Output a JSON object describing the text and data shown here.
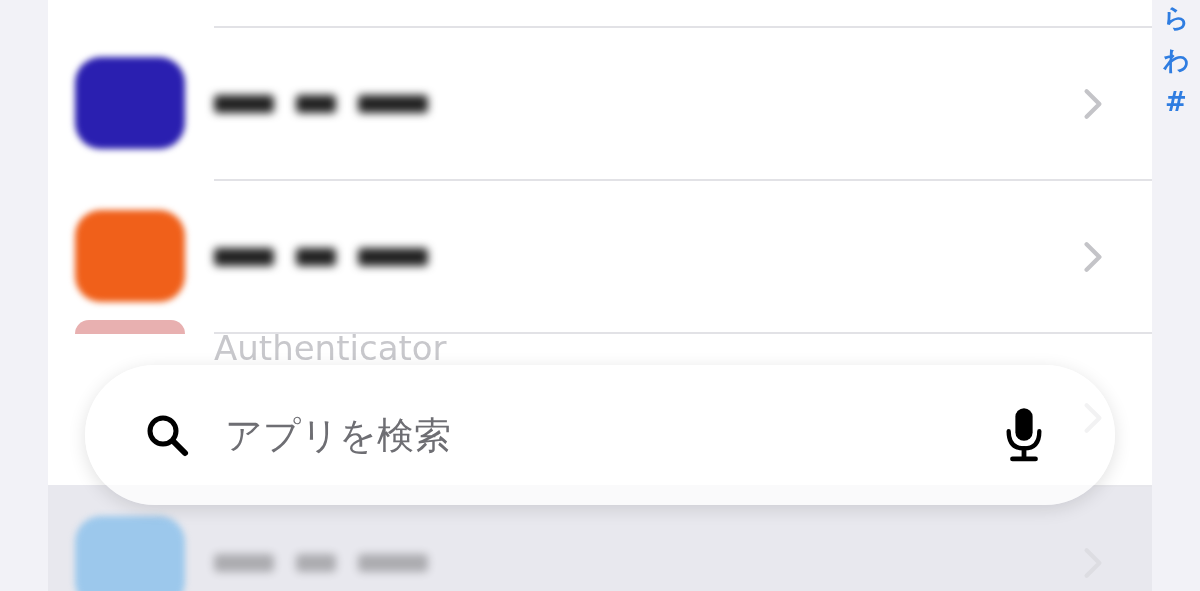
{
  "index": [
    "ら",
    "わ",
    "#"
  ],
  "rows": [
    {
      "kind": "blurred",
      "color": "#2a1fb0"
    },
    {
      "kind": "blurred",
      "color": "#f0601a"
    },
    {
      "kind": "named",
      "label": "Authenticator",
      "color": "#e8b0b0"
    },
    {
      "kind": "blurred",
      "color": "#9cc8ec"
    }
  ],
  "search": {
    "placeholder": "アプリを検索"
  }
}
